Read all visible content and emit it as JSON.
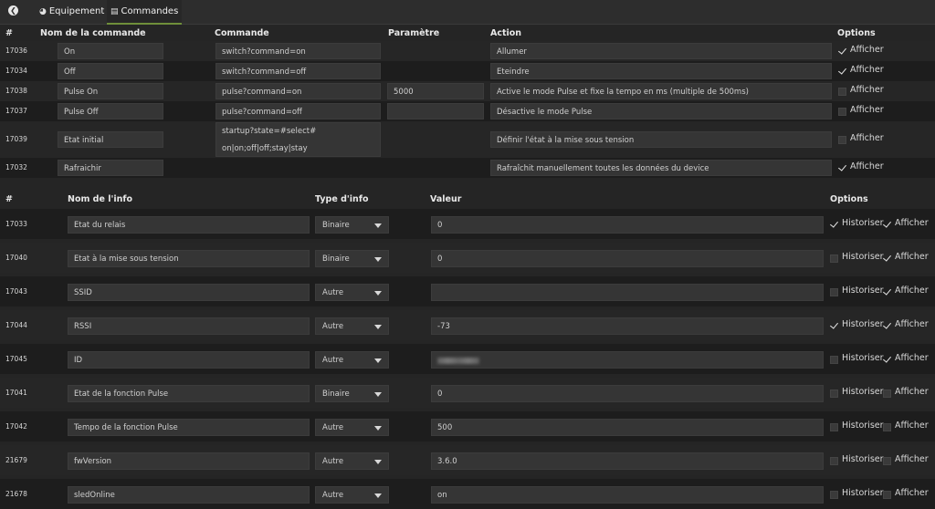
{
  "tabs": {
    "equipement": "Equipement",
    "commandes": "Commandes"
  },
  "commands": {
    "headers": {
      "num": "#",
      "name": "Nom de la commande",
      "command": "Commande",
      "param": "Paramètre",
      "action": "Action",
      "options": "Options"
    },
    "show_label": "Afficher",
    "rows": [
      {
        "id": "17036",
        "name": "On",
        "command": "switch?command=on",
        "param": "",
        "action": "Allumer",
        "show": true
      },
      {
        "id": "17034",
        "name": "Off",
        "command": "switch?command=off",
        "param": "",
        "action": "Eteindre",
        "show": true
      },
      {
        "id": "17038",
        "name": "Pulse On",
        "command": "pulse?command=on",
        "param": "5000",
        "action": "Active le mode Pulse et fixe la tempo en ms (multiple de 500ms)",
        "show": false
      },
      {
        "id": "17037",
        "name": "Pulse Off",
        "command": "pulse?command=off",
        "param": "",
        "action": "Désactive le mode Pulse",
        "show": false
      },
      {
        "id": "17039",
        "name": "Etat initial",
        "command": "startup?state=#select# on|on;off|off;stay|stay",
        "param": "",
        "action": "Définir l'état à la mise sous tension",
        "show": false
      },
      {
        "id": "17032",
        "name": "Rafraichir",
        "command": "",
        "param": "",
        "action": "Rafraîchit manuellement toutes les données du device",
        "show": true
      }
    ]
  },
  "infos": {
    "headers": {
      "num": "#",
      "name": "Nom de l'info",
      "type": "Type d'info",
      "value": "Valeur",
      "options": "Options"
    },
    "history_label": "Historiser",
    "show_label": "Afficher",
    "rows": [
      {
        "id": "17033",
        "name": "Etat du relais",
        "type": "Binaire",
        "value": "0",
        "historize": true,
        "show": true
      },
      {
        "id": "17040",
        "name": "Etat à la mise sous tension",
        "type": "Binaire",
        "value": "0",
        "historize": false,
        "show": true
      },
      {
        "id": "17043",
        "name": "SSID",
        "type": "Autre",
        "value": "",
        "historize": false,
        "show": true
      },
      {
        "id": "17044",
        "name": "RSSI",
        "type": "Autre",
        "value": "-73",
        "historize": true,
        "show": true
      },
      {
        "id": "17045",
        "name": "ID",
        "type": "Autre",
        "value": "",
        "blurred": true,
        "historize": false,
        "show": true
      },
      {
        "id": "17041",
        "name": "Etat de la fonction Pulse",
        "type": "Binaire",
        "value": "0",
        "historize": false,
        "show": false
      },
      {
        "id": "17042",
        "name": "Tempo de la fonction Pulse",
        "type": "Autre",
        "value": "500",
        "historize": false,
        "show": false
      },
      {
        "id": "21679",
        "name": "fwVersion",
        "type": "Autre",
        "value": "3.6.0",
        "historize": false,
        "show": false
      },
      {
        "id": "21678",
        "name": "sledOnline",
        "type": "Autre",
        "value": "on",
        "historize": false,
        "show": false
      }
    ]
  },
  "icons": {
    "back": "arrow-left-circle-icon",
    "equipement": "dashboard-icon",
    "commandes": "list-icon"
  },
  "colors": {
    "background": "#252525",
    "tab_active_underline": "#6f8f3a",
    "field_bg": "#353535"
  }
}
